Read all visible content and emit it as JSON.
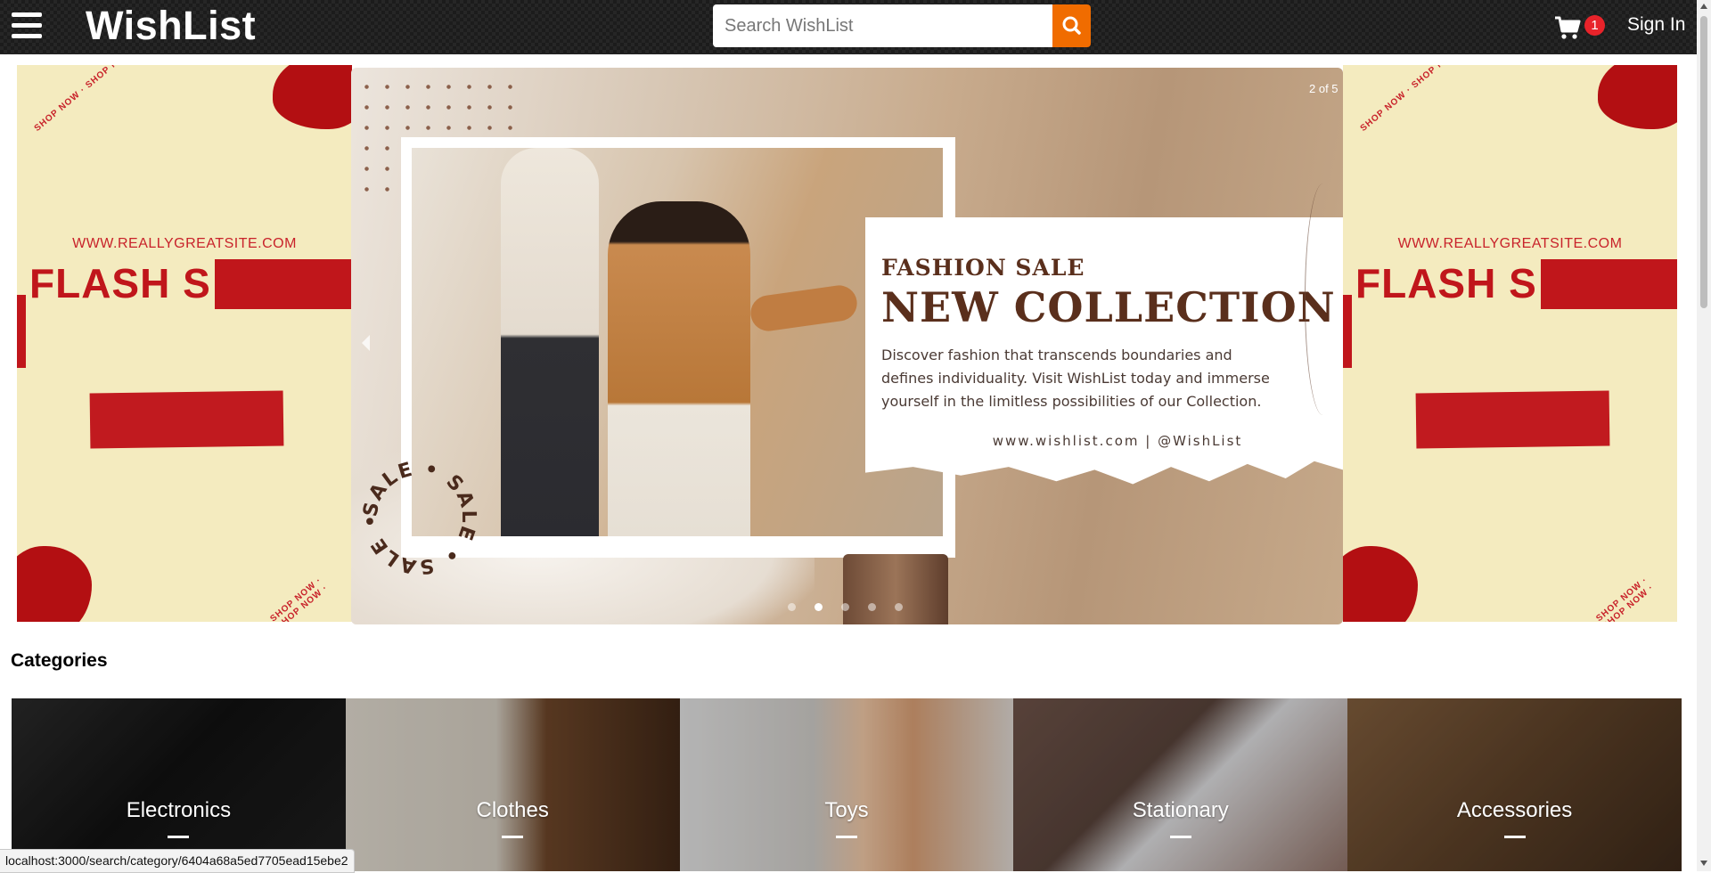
{
  "header": {
    "brand": "WishList",
    "search_placeholder": "Search WishList",
    "cart_count": "1",
    "signin_label": "Sign In"
  },
  "carousel": {
    "counter": "2 of 5",
    "side_slide": {
      "site": "WWW.REALLYGREATSITE.COM",
      "headline": "FLASH S",
      "stamp": "SHOP NOW · SHOP NOW ·"
    },
    "main_slide": {
      "kicker": "FASHION SALE",
      "title": "NEW COLLECTION",
      "body": "Discover fashion that transcends boundaries and defines individuality. Visit WishList today and immerse yourself in the limitless possibilities of our Collection.",
      "contact": "www.wishlist.com | @WishList",
      "ring_text": "SALE • SALE • SALE • "
    },
    "dots": 5,
    "active_dot": 2
  },
  "categories": {
    "title": "Categories",
    "items": [
      {
        "label": "Electronics"
      },
      {
        "label": "Clothes"
      },
      {
        "label": "Toys"
      },
      {
        "label": "Stationary"
      },
      {
        "label": "Accessories"
      }
    ]
  },
  "status_bar": {
    "url": "localhost:3000/search/category/6404a68a5ed7705ead15ebe2"
  },
  "colors": {
    "accent": "#f06c00",
    "badge": "#e8232a",
    "flash_red": "#c0161b",
    "flash_bg": "#f4ebbf",
    "card_brown": "#5a2f1c"
  },
  "icons": {
    "menu": "hamburger-icon",
    "search": "search-icon",
    "cart": "cart-icon",
    "prev": "chevron-left-icon"
  }
}
